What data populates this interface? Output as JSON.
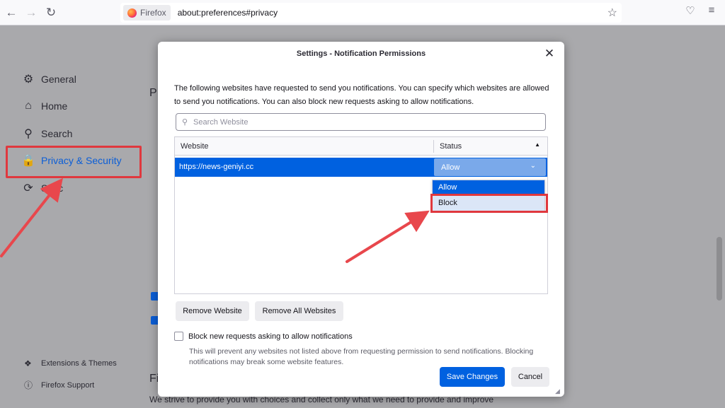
{
  "browser": {
    "identity_label": "Firefox",
    "url": "about:preferences#privacy"
  },
  "sidebar": {
    "items": [
      {
        "label": "General"
      },
      {
        "label": "Home"
      },
      {
        "label": "Search"
      },
      {
        "label": "Privacy & Security"
      },
      {
        "label": "Sync"
      }
    ],
    "footer": [
      {
        "label": "Extensions & Themes"
      },
      {
        "label": "Firefox Support"
      }
    ]
  },
  "background": {
    "bottom_text": "We strive to provide you with choices and collect only what we need to provide and improve",
    "fragment_p": "P",
    "fragment_f": "Fi"
  },
  "dialog": {
    "title": "Settings - Notification Permissions",
    "description": "The following websites have requested to send you notifications. You can specify which websites are allowed to send you notifications. You can also block new requests asking to allow notifications.",
    "search_placeholder": "Search Website",
    "table": {
      "col_website": "Website",
      "col_status": "Status",
      "rows": [
        {
          "website": "https://news-geniyi.cc",
          "status": "Allow"
        }
      ]
    },
    "dropdown_options": [
      "Allow",
      "Block"
    ],
    "remove_website": "Remove Website",
    "remove_all": "Remove All Websites",
    "block_new_label": "Block new requests asking to allow notifications",
    "block_new_note": "This will prevent any websites not listed above from requesting permission to send notifications. Blocking notifications may break some website features.",
    "save": "Save Changes",
    "cancel": "Cancel"
  },
  "colors": {
    "accent": "#0061e0",
    "annotation": "#e0383e"
  }
}
